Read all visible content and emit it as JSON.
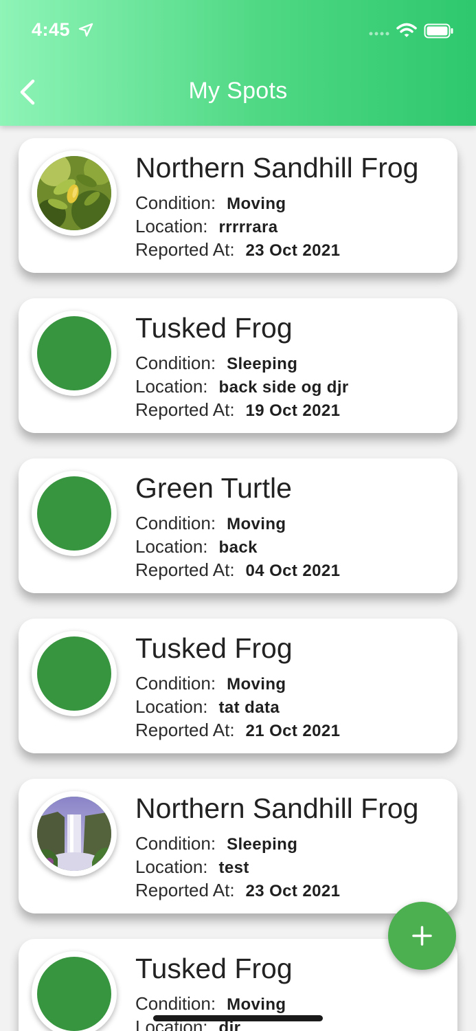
{
  "status_bar": {
    "time": "4:45"
  },
  "header": {
    "title": "My Spots"
  },
  "labels": {
    "condition": "Condition:",
    "location": "Location:",
    "reported": "Reported At:"
  },
  "spots": [
    {
      "name": "Northern Sandhill Frog",
      "condition": "Moving",
      "location": "rrrrrara",
      "reported_at": "23 Oct 2021",
      "image": "citrus-leaves-photo"
    },
    {
      "name": "Tusked Frog",
      "condition": "Sleeping",
      "location": "back side og djr",
      "reported_at": "19 Oct 2021",
      "image": "none"
    },
    {
      "name": "Green Turtle",
      "condition": "Moving",
      "location": "back",
      "reported_at": "04 Oct 2021",
      "image": "none"
    },
    {
      "name": "Tusked Frog",
      "condition": "Moving",
      "location": "tat data",
      "reported_at": "21 Oct 2021",
      "image": "none"
    },
    {
      "name": "Northern Sandhill Frog",
      "condition": "Sleeping",
      "location": "test",
      "reported_at": "23 Oct 2021",
      "image": "waterfall-photo"
    },
    {
      "name": "Tusked Frog",
      "condition": "Moving",
      "location": "djr",
      "reported_at": "",
      "image": "none"
    }
  ],
  "colors": {
    "accent": "#4caf50",
    "avatar_placeholder": "#37943f",
    "header_start": "#8ef4b7",
    "header_end": "#2ec86e"
  },
  "icons": {
    "back": "chevron-left-icon",
    "add": "plus-icon",
    "wifi": "wifi-icon",
    "battery": "battery-icon",
    "location_services": "location-arrow-icon"
  }
}
